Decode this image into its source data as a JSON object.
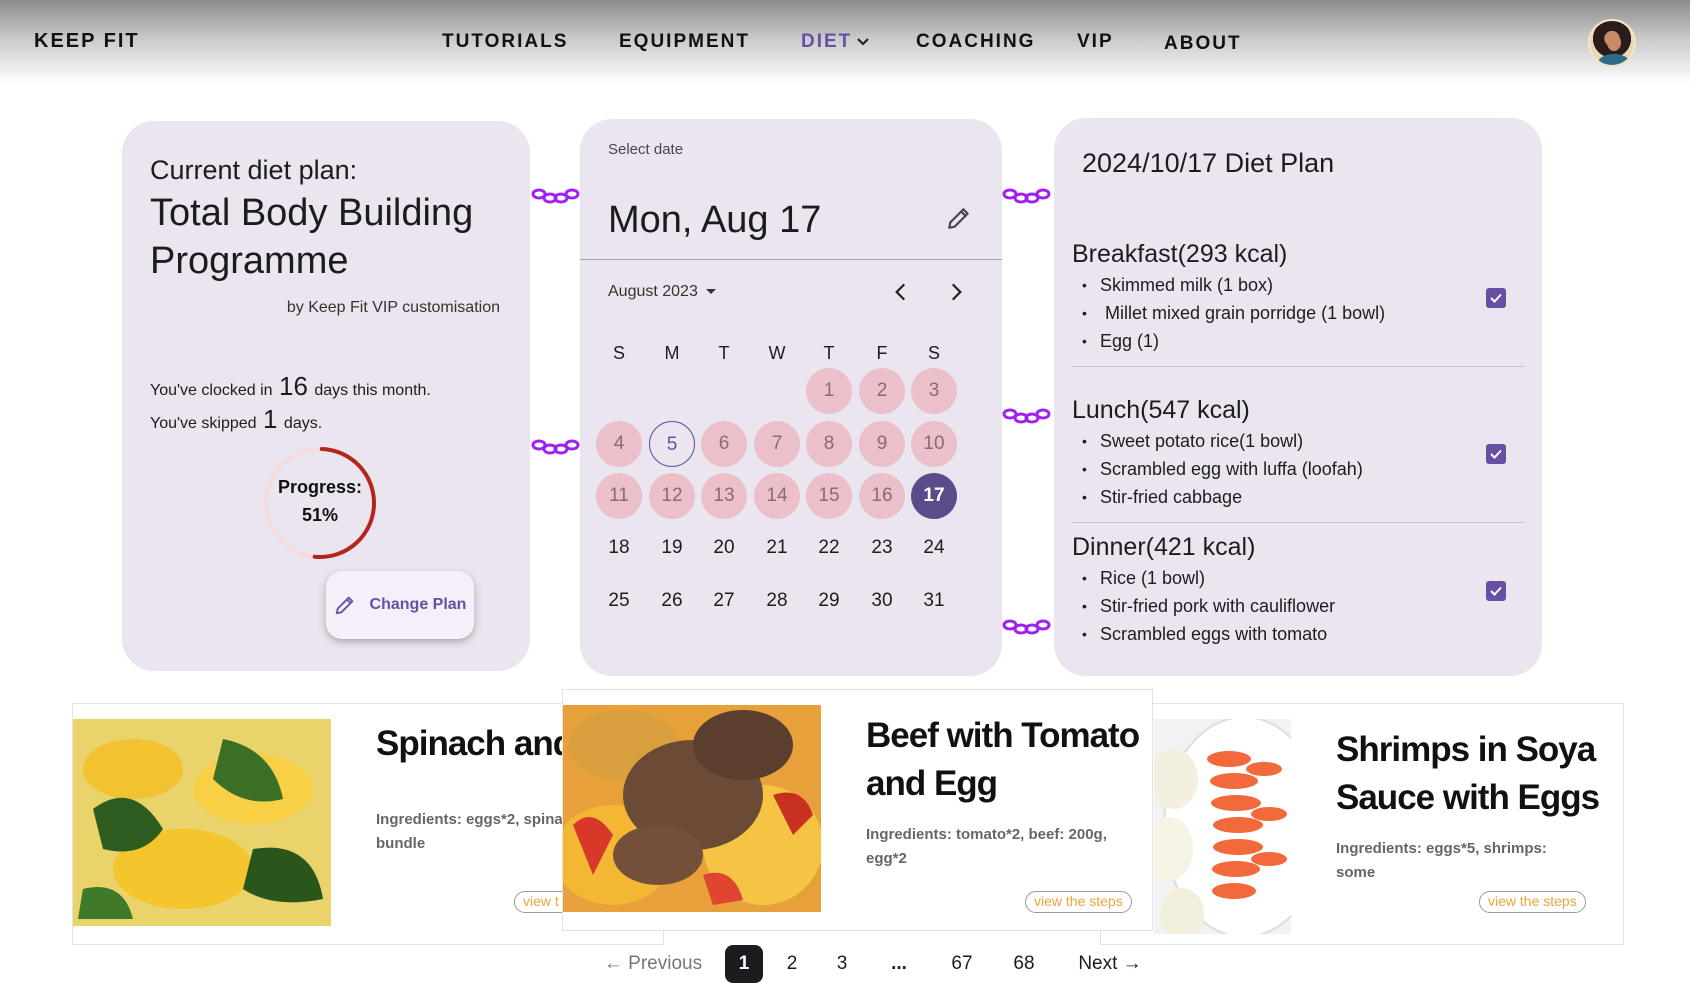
{
  "nav": {
    "brand": "KEEP FIT",
    "items": [
      {
        "label": "TUTORIALS"
      },
      {
        "label": "EQUIPMENT"
      },
      {
        "label": "DIET",
        "active": true
      },
      {
        "label": "COACHING"
      },
      {
        "label": "VIP"
      },
      {
        "label": "ABOUT"
      }
    ],
    "active_color": "#6750a4"
  },
  "plan": {
    "label": "Current diet plan:",
    "title": "Total Body Building Programme",
    "by": "by Keep Fit VIP customisation",
    "clocked_prefix": "You've clocked in",
    "clocked_days": "16",
    "clocked_suffix": "days this month.",
    "skipped_prefix": "You've skipped",
    "skipped_days": "1",
    "skipped_suffix": "days.",
    "progress_label": "Progress:",
    "progress_value": "51%",
    "progress_fraction": 0.51,
    "change_button": "Change Plan"
  },
  "calendar": {
    "select_label": "Select date",
    "headline": "Mon, Aug 17",
    "month_label": "August 2023",
    "weekdays": [
      "S",
      "M",
      "T",
      "W",
      "T",
      "F",
      "S"
    ],
    "first_weekday_index": 4,
    "days_in_month": 31,
    "completed_days": [
      1,
      2,
      3,
      4,
      6,
      7,
      8,
      9,
      10,
      11,
      12,
      13,
      14,
      15,
      16
    ],
    "today": 5,
    "selected": 17
  },
  "diet": {
    "title": "2024/10/17 Diet Plan",
    "meals": [
      {
        "heading": "Breakfast(293 kcal)",
        "items": [
          "Skimmed milk (1 box)",
          " Millet mixed grain porridge (1 bowl)",
          "Egg (1)"
        ],
        "checked": true
      },
      {
        "heading": "Lunch(547 kcal)",
        "items": [
          "Sweet potato rice(1 bowl)",
          "Scrambled egg with luffa (loofah)",
          "Stir-fried cabbage"
        ],
        "checked": true
      },
      {
        "heading": "Dinner(421 kcal)",
        "items": [
          "Rice (1 bowl)",
          "Stir-fried pork with cauliflower",
          "Scrambled eggs with tomato"
        ],
        "checked": true
      }
    ]
  },
  "recipes": [
    {
      "title": "Spinach and",
      "ingredients_line1": "Ingredients: eggs*2, spina",
      "ingredients_line2": "bundle",
      "steps": "view t"
    },
    {
      "title_line1": "Beef with Tomato",
      "title_line2": "and Egg",
      "ingredients_line1": "Ingredients: tomato*2, beef: 200g,",
      "ingredients_line2": "egg*2",
      "steps": "view the steps"
    },
    {
      "title_line1": "Shrimps in Soya",
      "title_line2": "Sauce with Eggs",
      "ingredients_line1": "Ingredients: eggs*5, shrimps:",
      "ingredients_line2": "some",
      "steps": "view the steps"
    }
  ],
  "pagination": {
    "previous": "Previous",
    "next": "Next",
    "pages": [
      "1",
      "2",
      "3",
      "...",
      "67",
      "68"
    ],
    "current": "1"
  }
}
